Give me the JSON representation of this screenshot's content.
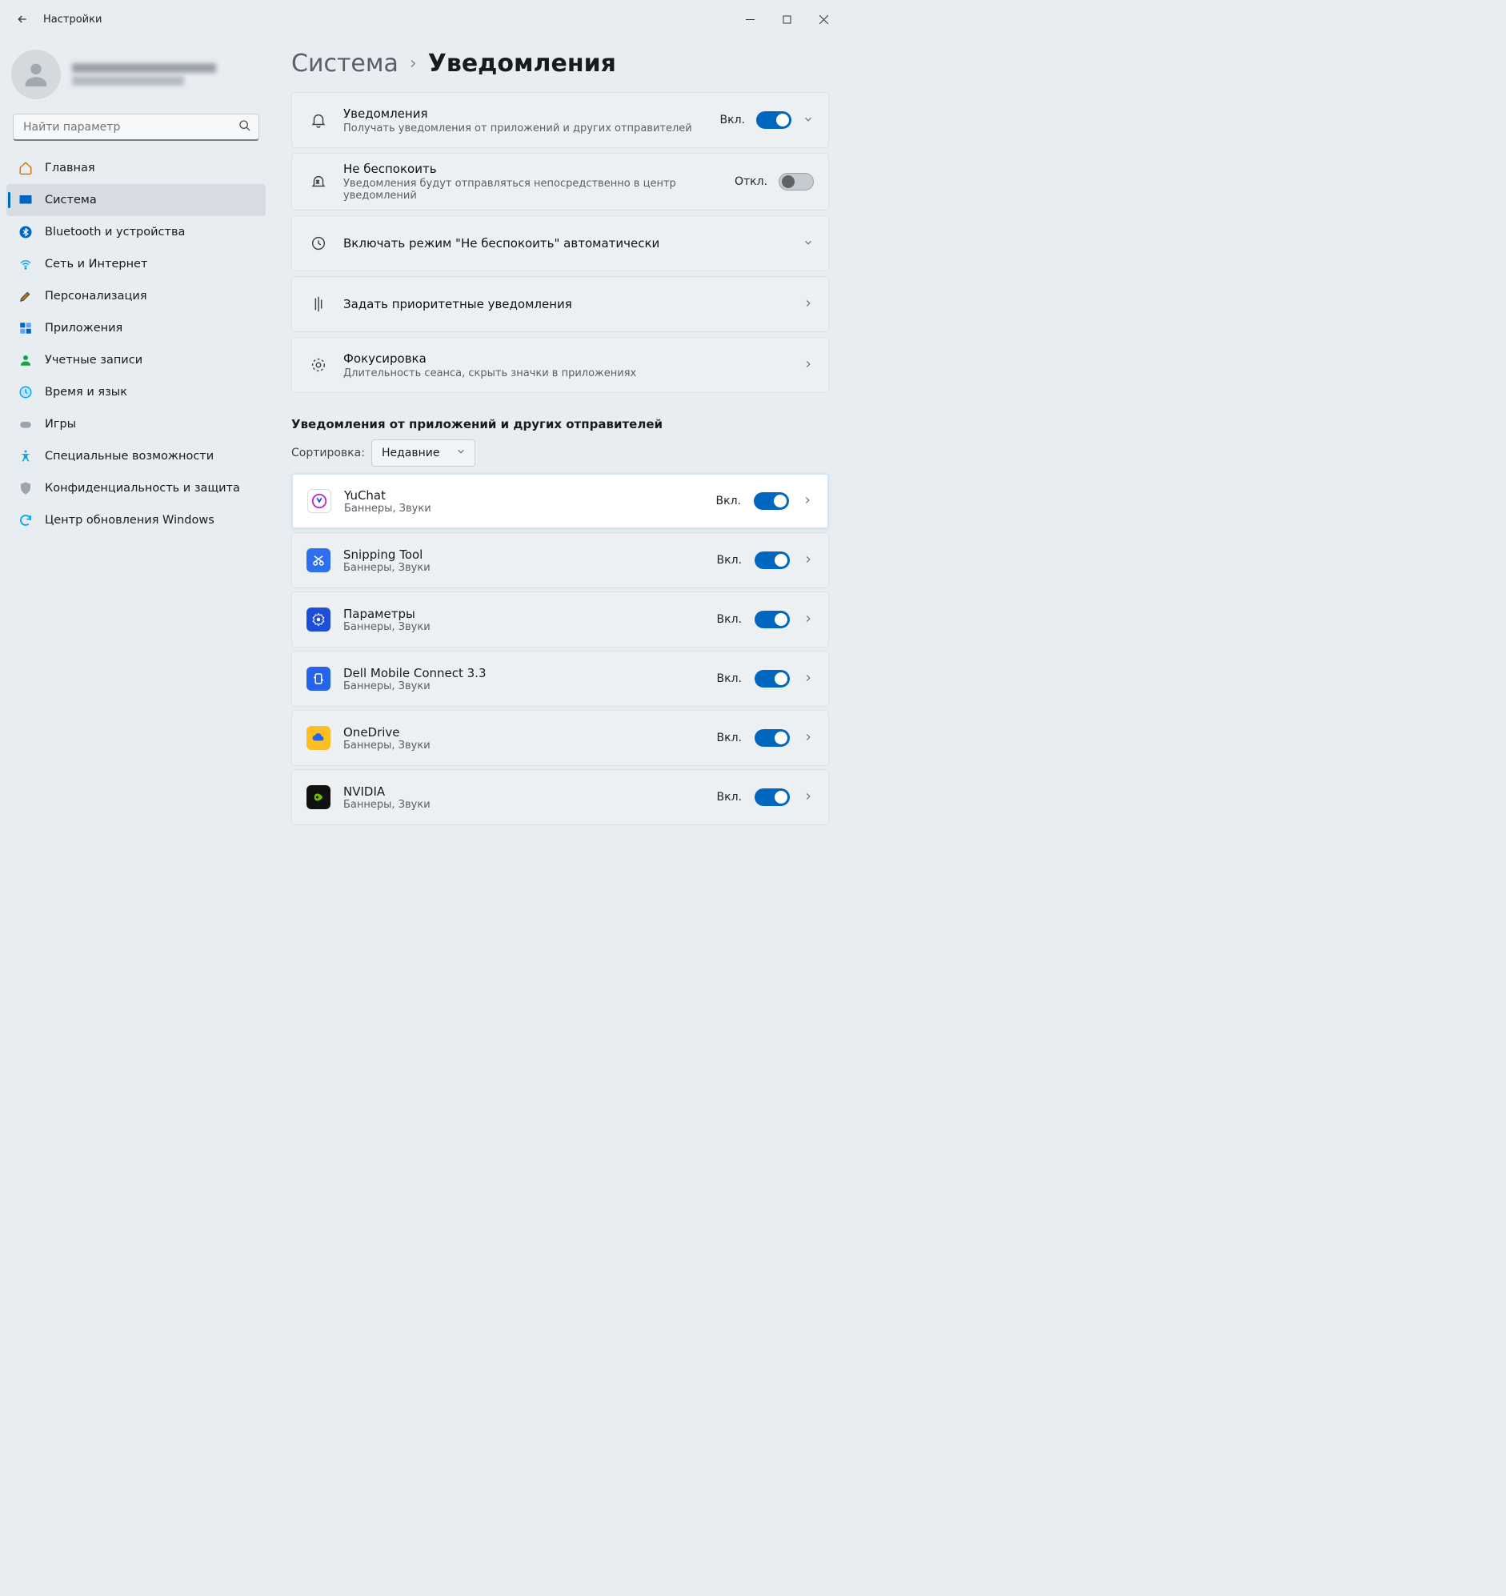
{
  "window": {
    "title": "Настройки"
  },
  "search": {
    "placeholder": "Найти параметр"
  },
  "nav": [
    {
      "label": "Главная"
    },
    {
      "label": "Система"
    },
    {
      "label": "Bluetooth и устройства"
    },
    {
      "label": "Сеть и Интернет"
    },
    {
      "label": "Персонализация"
    },
    {
      "label": "Приложения"
    },
    {
      "label": "Учетные записи"
    },
    {
      "label": "Время и язык"
    },
    {
      "label": "Игры"
    },
    {
      "label": "Специальные возможности"
    },
    {
      "label": "Конфиденциальность и защита"
    },
    {
      "label": "Центр обновления Windows"
    }
  ],
  "breadcrumb": {
    "parent": "Система",
    "current": "Уведомления"
  },
  "cards": {
    "notifications": {
      "title": "Уведомления",
      "sub": "Получать уведомления от приложений и других отправителей",
      "state": "Вкл."
    },
    "dnd": {
      "title": "Не беспокоить",
      "sub": "Уведомления будут отправляться непосредственно в центр уведомлений",
      "state": "Откл."
    },
    "auto_dnd": {
      "title": "Включать режим \"Не беспокоить\" автоматически"
    },
    "priority": {
      "title": "Задать приоритетные уведомления"
    },
    "focus": {
      "title": "Фокусировка",
      "sub": "Длительность сеанса, скрыть значки в приложениях"
    }
  },
  "apps_section": {
    "title": "Уведомления от приложений и других отправителей",
    "sort_label": "Сортировка:",
    "sort_value": "Недавние"
  },
  "apps": [
    {
      "name": "YuChat",
      "sub": "Баннеры, Звуки",
      "state": "Вкл."
    },
    {
      "name": "Snipping Tool",
      "sub": "Баннеры, Звуки",
      "state": "Вкл."
    },
    {
      "name": "Параметры",
      "sub": "Баннеры, Звуки",
      "state": "Вкл."
    },
    {
      "name": "Dell Mobile Connect 3.3",
      "sub": "Баннеры, Звуки",
      "state": "Вкл."
    },
    {
      "name": "OneDrive",
      "sub": "Баннеры, Звуки",
      "state": "Вкл."
    },
    {
      "name": "NVIDIA",
      "sub": "Баннеры, Звуки",
      "state": "Вкл."
    }
  ]
}
